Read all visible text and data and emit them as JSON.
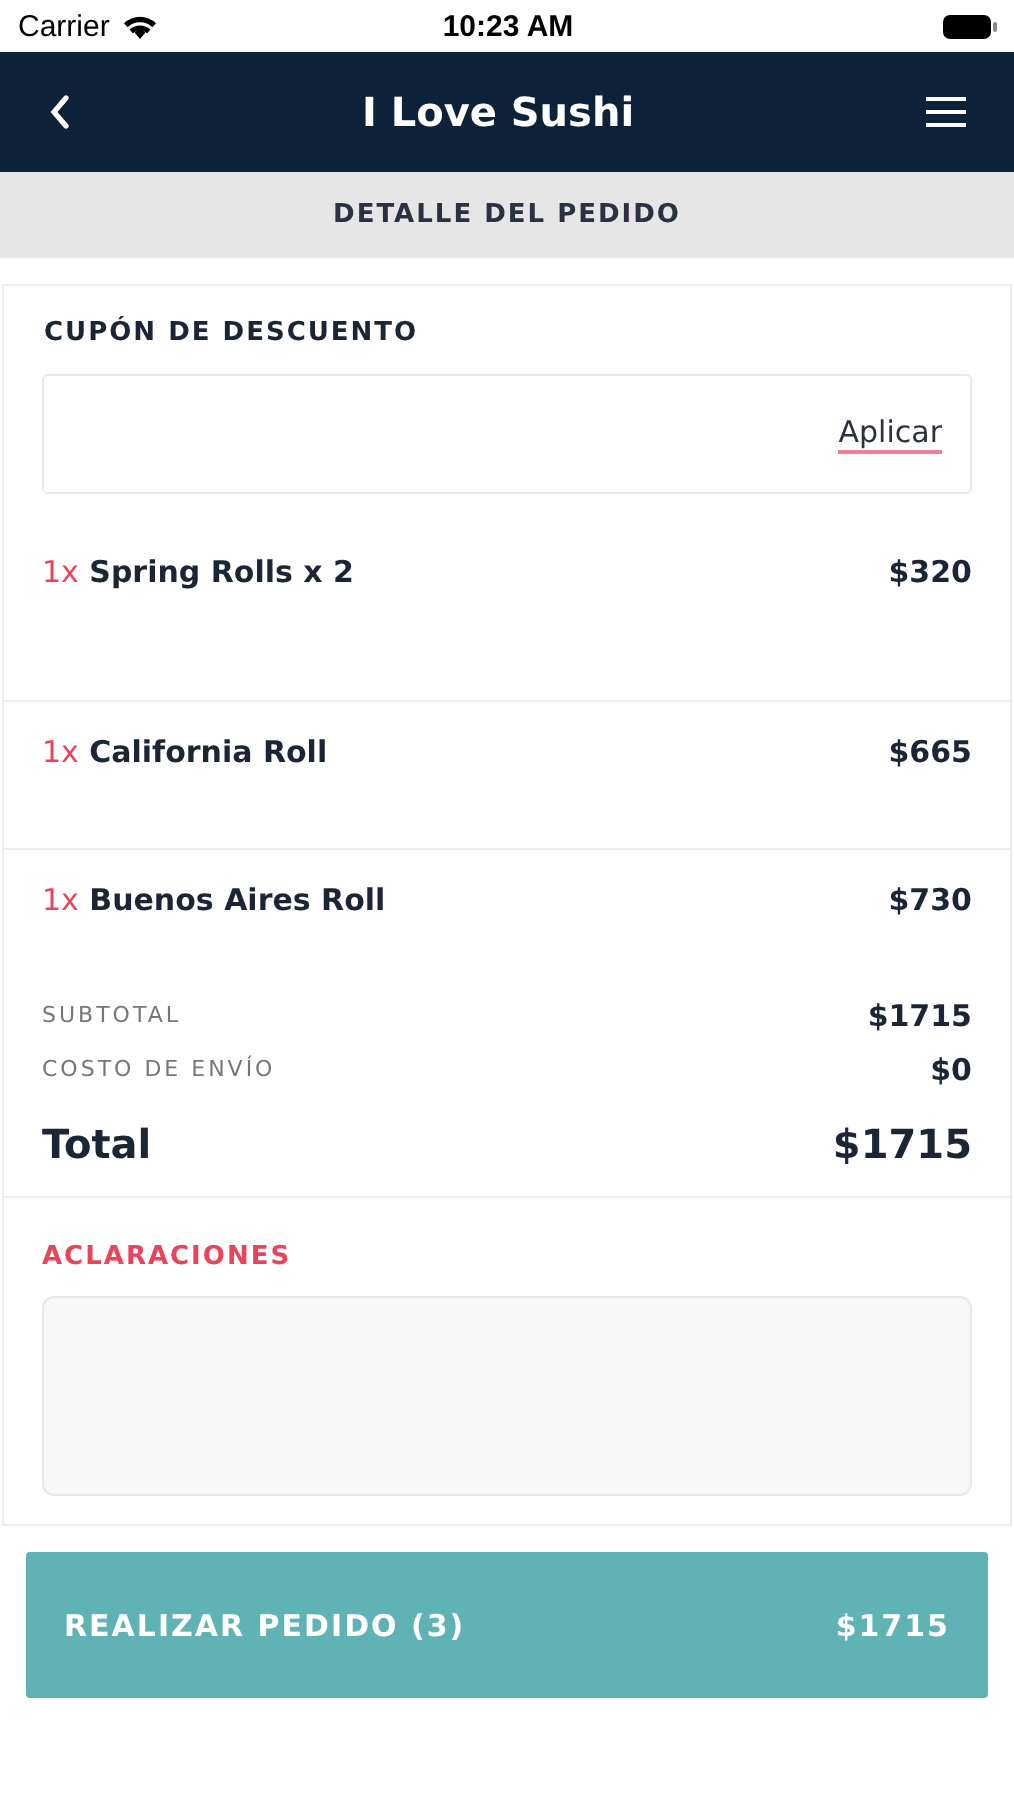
{
  "status_bar": {
    "carrier": "Carrier",
    "time": "10:23 AM"
  },
  "nav": {
    "title": "I Love Sushi"
  },
  "section_header": "DETALLE DEL PEDIDO",
  "coupon": {
    "title": "CUPÓN DE DESCUENTO",
    "apply": "Aplicar"
  },
  "items": [
    {
      "qty": "1x",
      "name": "Spring Rolls x 2",
      "price": "$320"
    },
    {
      "qty": "1x",
      "name": "California Roll",
      "price": "$665"
    },
    {
      "qty": "1x",
      "name": "Buenos Aires Roll",
      "price": "$730"
    }
  ],
  "summary": [
    {
      "label": "SUBTOTAL",
      "value": "$1715"
    },
    {
      "label": "COSTO DE ENVÍO",
      "value": "$0"
    }
  ],
  "total": {
    "label": "Total",
    "value": "$1715"
  },
  "notes": {
    "title": "ACLARACIONES"
  },
  "order_button": {
    "label": "REALIZAR PEDIDO (3)",
    "amount": "$1715"
  }
}
